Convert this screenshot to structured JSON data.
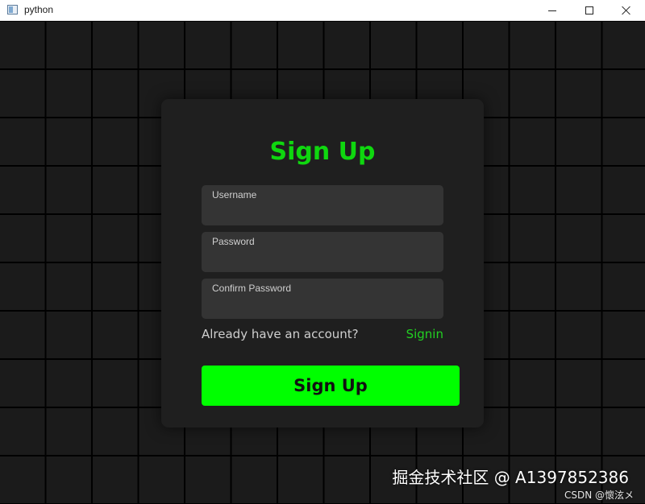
{
  "window": {
    "title": "python",
    "icon": "app-window-icon",
    "controls": {
      "minimize_icon": "minimize-icon",
      "maximize_icon": "maximize-icon",
      "close_icon": "close-icon"
    }
  },
  "form": {
    "title": "Sign Up",
    "fields": [
      {
        "label": "Username",
        "value": ""
      },
      {
        "label": "Password",
        "value": ""
      },
      {
        "label": "Confirm Password",
        "value": ""
      }
    ],
    "account_prompt": "Already have an account?",
    "signin_link": "Signin",
    "submit_label": "Sign Up"
  },
  "watermark": {
    "main": "掘金技术社区 @ A1397852386",
    "sub": "CSDN @懷泫メ"
  },
  "colors": {
    "background": "#1b1b1b",
    "grid_lines": "#000000",
    "card": "#1f1f1f",
    "field": "#343434",
    "accent_green": "#0fd70f",
    "button_green": "#00ff00"
  }
}
